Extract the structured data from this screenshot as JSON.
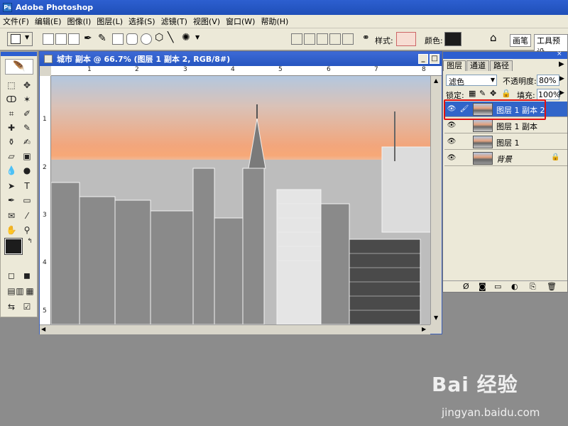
{
  "app": {
    "title": "Adobe Photoshop"
  },
  "menu": {
    "items": [
      "文件(F)",
      "编辑(E)",
      "图像(I)",
      "图层(L)",
      "选择(S)",
      "滤镜(T)",
      "视图(V)",
      "窗口(W)",
      "帮助(H)"
    ]
  },
  "options": {
    "style_label": "样式:",
    "color_label": "颜色:",
    "tab_brushes": "画笔",
    "tab_presets": "工具预设"
  },
  "document": {
    "title": "城市 副本 @ 66.7% (图层 1 副本 2, RGB/8#)",
    "ruler_top": [
      "1",
      "2",
      "3",
      "4",
      "5",
      "6",
      "7",
      "8"
    ],
    "ruler_left": [
      "1",
      "2",
      "3",
      "4",
      "5"
    ]
  },
  "layers": {
    "tabs": [
      "图层",
      "通道",
      "路径"
    ],
    "blend_mode": "滤色",
    "opacity_label": "不透明度:",
    "opacity_value": "80%",
    "lock_label": "锁定:",
    "fill_label": "填充:",
    "fill_value": "100%",
    "rows": [
      {
        "name": "图层 1 副本 2"
      },
      {
        "name": "图层 1 副本"
      },
      {
        "name": "图层 1"
      },
      {
        "name": "背景"
      }
    ]
  },
  "watermark": {
    "logo": "Bai 经验",
    "sub": "jingyan.baidu.com"
  },
  "colors": {
    "selection": "#3165c9",
    "highlight_box": "#e01010",
    "titlebar": "#2d5fd0"
  }
}
